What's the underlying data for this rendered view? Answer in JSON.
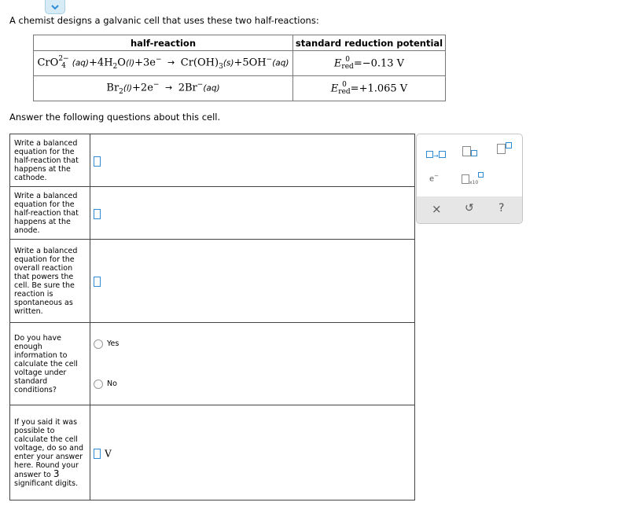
{
  "intro_text": "A chemist designs a galvanic cell that uses these two half-reactions:",
  "table": {
    "col1_header": "half-reaction",
    "col2_header": "standard reduction potential",
    "rows": [
      {
        "cro4": "CrO",
        "cro4_sub": "4",
        "cro4_sup": "2−",
        "phase_aq1": "(aq)",
        "plus4h2": "+4H",
        "h2o_sub": "2",
        "o": "O",
        "phase_l": "(l)",
        "plus3e": "+3e",
        "e_sup": "−",
        "product": "Cr(OH)",
        "prod_sub": "3",
        "phase_s": "(s)",
        "plus5oh": "+5OH",
        "oh_sup": "−",
        "phase_aq2": "(aq)",
        "E": "E",
        "E_sup": "0",
        "E_sub": "red",
        "value": "=−0.13 V"
      },
      {
        "br": "Br",
        "br_sub": "2",
        "phase_l": "(l)",
        "plus2e": "+2e",
        "e_sup": "−",
        "product": "2Br",
        "prod_sup": "−",
        "phase_aq": "(aq)",
        "E": "E",
        "E_sup": "0",
        "E_sub": "red",
        "value": "=+1.065 V"
      }
    ]
  },
  "answer_text": "Answer the following questions about this cell.",
  "questions": {
    "q1": "Write a balanced equation for the half-reaction that happens at the cathode.",
    "q2": "Write a balanced equation for the half-reaction that happens at the anode.",
    "q3": "Write a balanced equation for the overall reaction that powers the cell. Be sure the reaction is spontaneous as written.",
    "q4": "Do you have enough information to calculate the cell voltage under standard conditions?",
    "q4_yes": "Yes",
    "q4_no": "No",
    "q5_a": "If you said it was possible to calculate the cell voltage, do so and enter your answer here. Round your answer to",
    "q5_num": "3",
    "q5_b": "significant digits.",
    "q5_unit": "V"
  },
  "palette": {
    "electron_label": "e",
    "electron_sup": "−",
    "x10_label": "x10",
    "clear_symbol": "×",
    "undo_symbol": "↺",
    "help_symbol": "?"
  },
  "colors": {
    "accent": "#2f8bd1",
    "palette_bottom": "#e6e6e6",
    "collapse_bg": "#d7ebf7"
  }
}
